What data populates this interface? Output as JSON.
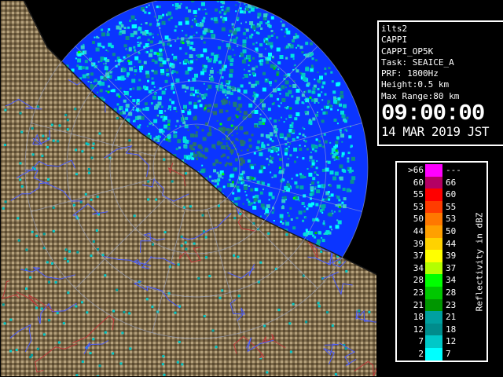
{
  "radar": {
    "colors": {
      "no_echo": "#0b35ff",
      "land_base": "#7d6a4a",
      "land_dark": "#5a4a30",
      "land_light": "#b5a17c",
      "coast": "#1a1a1a",
      "ring": "#9aa6c8",
      "river": "#4a5cff",
      "border": "#c03a3a"
    }
  },
  "info": {
    "station": "ilts2",
    "product": "CAPPI",
    "product_id": "CAPPI_OP5K",
    "task": "Task: SEAICE_A",
    "prf": "PRF: 1800Hz",
    "height": "Height:0.5 km",
    "max_range": "Max Range:80 km",
    "time": "09:00:00",
    "date": "14 MAR 2019 JST"
  },
  "legend": {
    "unit": "Reflectivity in dBZ",
    "rows": [
      {
        "low": ">66",
        "high": "---",
        "color": "#ff00ff"
      },
      {
        "low": "60",
        "high": "66",
        "color": "#b40064"
      },
      {
        "low": "55",
        "high": "60",
        "color": "#ff0000"
      },
      {
        "low": "53",
        "high": "55",
        "color": "#ff3c00"
      },
      {
        "low": "50",
        "high": "53",
        "color": "#ff7800"
      },
      {
        "low": "44",
        "high": "50",
        "color": "#ffa000"
      },
      {
        "low": "39",
        "high": "44",
        "color": "#ffd200"
      },
      {
        "low": "37",
        "high": "39",
        "color": "#ffff00"
      },
      {
        "low": "34",
        "high": "37",
        "color": "#b4ff00"
      },
      {
        "low": "28",
        "high": "34",
        "color": "#00ff00"
      },
      {
        "low": "23",
        "high": "28",
        "color": "#00c800"
      },
      {
        "low": "21",
        "high": "23",
        "color": "#009600"
      },
      {
        "low": "18",
        "high": "21",
        "color": "#00a0a0"
      },
      {
        "low": "12",
        "high": "18",
        "color": "#008c8c"
      },
      {
        "low": "7",
        "high": "12",
        "color": "#00c8c8"
      },
      {
        "low": "2",
        "high": "7",
        "color": "#00ffff"
      }
    ]
  }
}
